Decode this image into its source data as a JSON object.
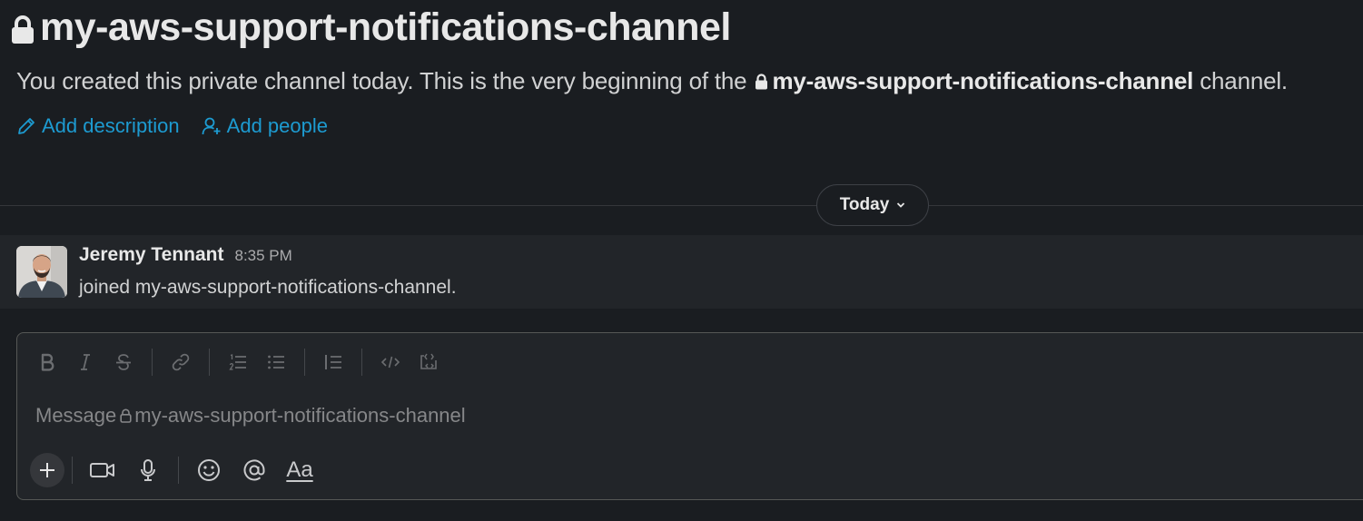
{
  "channel": {
    "name": "my-aws-support-notifications-channel",
    "intro_prefix": "You created this private channel today. This is the very beginning of the",
    "intro_suffix": "channel."
  },
  "actions": {
    "add_description": "Add description",
    "add_people": "Add people"
  },
  "divider": {
    "label": "Today"
  },
  "message": {
    "author": "Jeremy Tennant",
    "time": "8:35 PM",
    "text": "joined my-aws-support-notifications-channel."
  },
  "composer": {
    "placeholder_prefix": "Message",
    "placeholder_channel": "my-aws-support-notifications-channel",
    "format_buttons": [
      "bold-icon",
      "italic-icon",
      "strikethrough-icon",
      "link-icon",
      "ordered-list-icon",
      "bullet-list-icon",
      "blockquote-icon",
      "code-icon",
      "code-block-icon"
    ],
    "font_button_label": "Aa"
  },
  "colors": {
    "background": "#1a1d21",
    "message_row": "#222529",
    "link": "#1d9bd1",
    "text": "#d1d2d3"
  }
}
